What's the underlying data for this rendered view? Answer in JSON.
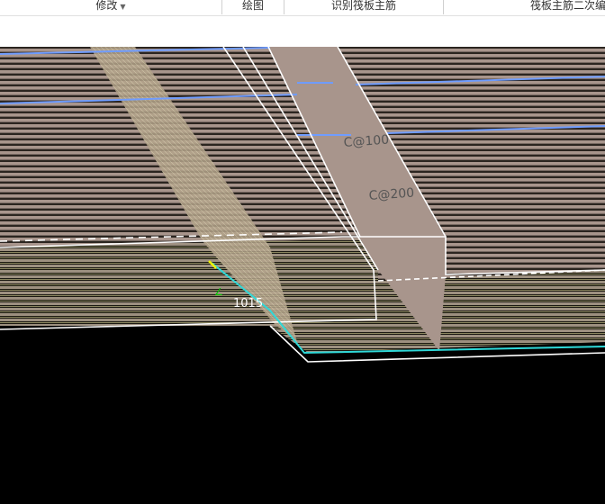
{
  "ribbon": {
    "groups": [
      {
        "label": "修改",
        "has_dropdown": true
      },
      {
        "label": "绘图"
      },
      {
        "label": "识别筏板主筋"
      },
      {
        "label": "筏板主筋二次编"
      }
    ]
  },
  "viewport": {
    "dimension_label": "1015",
    "rebar_annotations": [
      "C@100",
      "C@200"
    ],
    "colors": {
      "slab": "#a8958c",
      "edge": "#ffffff",
      "blue_rebar": "#6f9cff",
      "cyan_edge": "#2fd8d8",
      "green_text": "#00c000"
    }
  }
}
